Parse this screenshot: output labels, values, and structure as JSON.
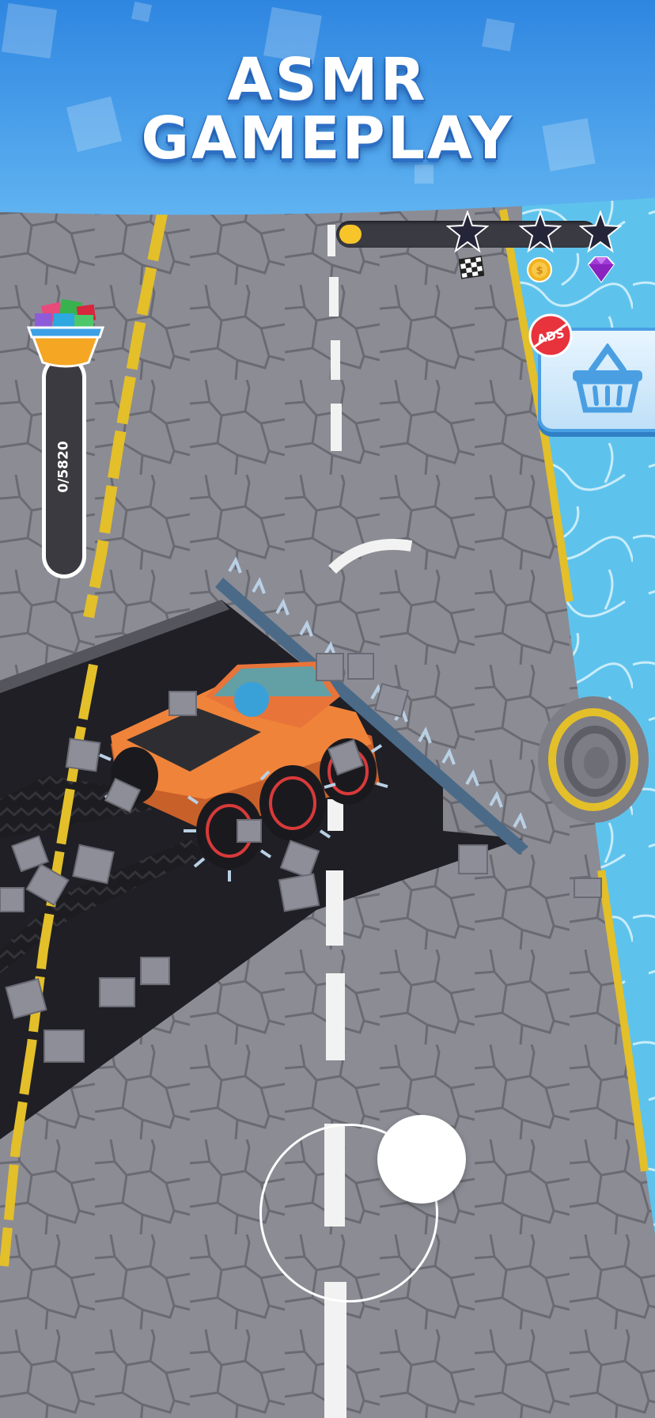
{
  "banner": {
    "title_line1": "ASMR",
    "title_line2": "GAMEPLAY",
    "color_top": "#2f86e0",
    "color_bottom": "#5fb3f1"
  },
  "hud": {
    "level_progress": 0.06,
    "stars_earned": 0,
    "stars_total": 3,
    "progress_fill_color": "#f7c52a",
    "icons": [
      "checkered-flag-icon",
      "coin-icon",
      "gem-icon"
    ]
  },
  "collect_meter": {
    "label": "0/5820",
    "collected": 0,
    "capacity": 5820
  },
  "shop": {
    "no_ads_label": "ADS",
    "icon": "shopping-basket-icon"
  },
  "colors": {
    "road": "#8a8a93",
    "cleared_road": "#1f1f24",
    "lane_yellow": "#e8c22c",
    "water": "#5cc4ee",
    "truck_orange": "#f0833a",
    "spike_steel": "#9fb7cc"
  },
  "controls": {
    "joystick": "virtual-joystick"
  }
}
